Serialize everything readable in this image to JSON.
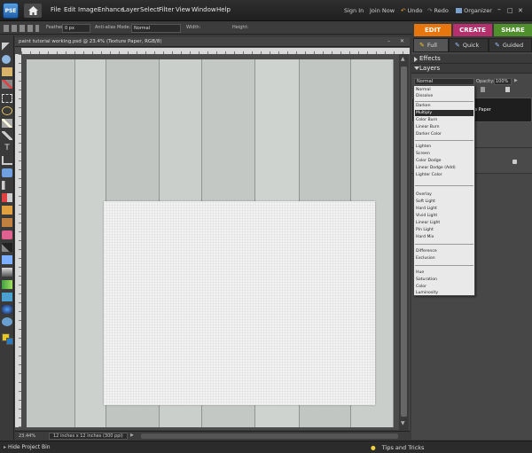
{
  "app": {
    "logo_text": "PSE"
  },
  "menu": [
    "File",
    "Edit",
    "Image",
    "Enhance",
    "Layer",
    "Select",
    "Filter",
    "View",
    "Window",
    "Help"
  ],
  "top_links": {
    "sign_in": "Sign In",
    "join_now": "Join Now",
    "undo": "Undo",
    "redo": "Redo",
    "organizer": "Organizer"
  },
  "options": {
    "feather_label": "Feather:",
    "feather_value": "0 px",
    "anti_alias": "Anti-alias",
    "mode_label": "Mode:",
    "mode_value": "Normal",
    "width_label": "Width:",
    "height_label": "Height:"
  },
  "mode_tabs": {
    "edit": "EDIT",
    "create": "CREATE",
    "share": "SHARE"
  },
  "sub_tabs": {
    "full": "Full",
    "quick": "Quick",
    "guided": "Guided"
  },
  "document": {
    "title": "paint tutorial working.psd @ 23.4% (Texture Paper, RGB/8)",
    "zoom": "23.44%",
    "doc_size": "12 inches x 12 inches (300 ppi)"
  },
  "panels": {
    "effects": "Effects",
    "layers": "Layers",
    "opacity_label": "Opacity:",
    "opacity_value": "100%",
    "layer_name": "e Paper"
  },
  "blend": {
    "current": "Normal",
    "groups": [
      [
        "Normal",
        "Dissolve"
      ],
      [
        "Darken",
        "Multiply",
        "Color Burn",
        "Linear Burn",
        "Darker Color"
      ],
      [
        "Lighten",
        "Screen",
        "Color Dodge",
        "Linear Dodge (Add)",
        "Lighter Color"
      ],
      [
        "Overlay",
        "Soft Light",
        "Hard Light",
        "Vivid Light",
        "Linear Light",
        "Pin Light",
        "Hard Mix"
      ],
      [
        "Difference",
        "Exclusion"
      ],
      [
        "Hue",
        "Saturation",
        "Color",
        "Luminosity"
      ]
    ],
    "selected": "Multiply"
  },
  "bottom": {
    "hide_bin": "Hide Project Bin",
    "tips": "Tips and Tricks"
  },
  "colors": {
    "edit": "#e8760e",
    "create": "#b4316e",
    "share": "#4f8f2c"
  }
}
